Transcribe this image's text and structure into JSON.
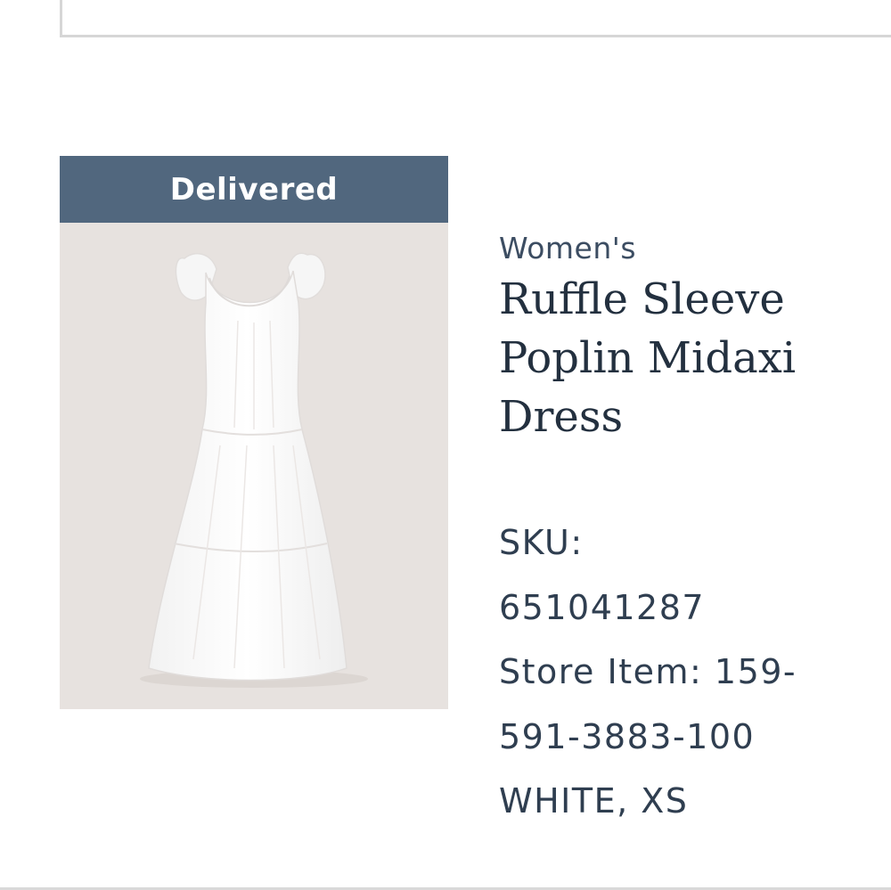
{
  "order_item": {
    "status": "Delivered",
    "category": "Women's",
    "name": "Ruffle Sleeve Poplin Midaxi Dress",
    "sku_label": "SKU:",
    "sku": "651041287",
    "store_item_line1": "Store Item: 159-",
    "store_item_line2": "591-3883-100",
    "variant": "WHITE, XS",
    "image_alt": "white ruffle sleeve midaxi dress",
    "image_icon": "dress-photo"
  },
  "colors": {
    "banner": "#51677e",
    "image_background": "#e7e2df",
    "text": "#2b3a4d"
  }
}
